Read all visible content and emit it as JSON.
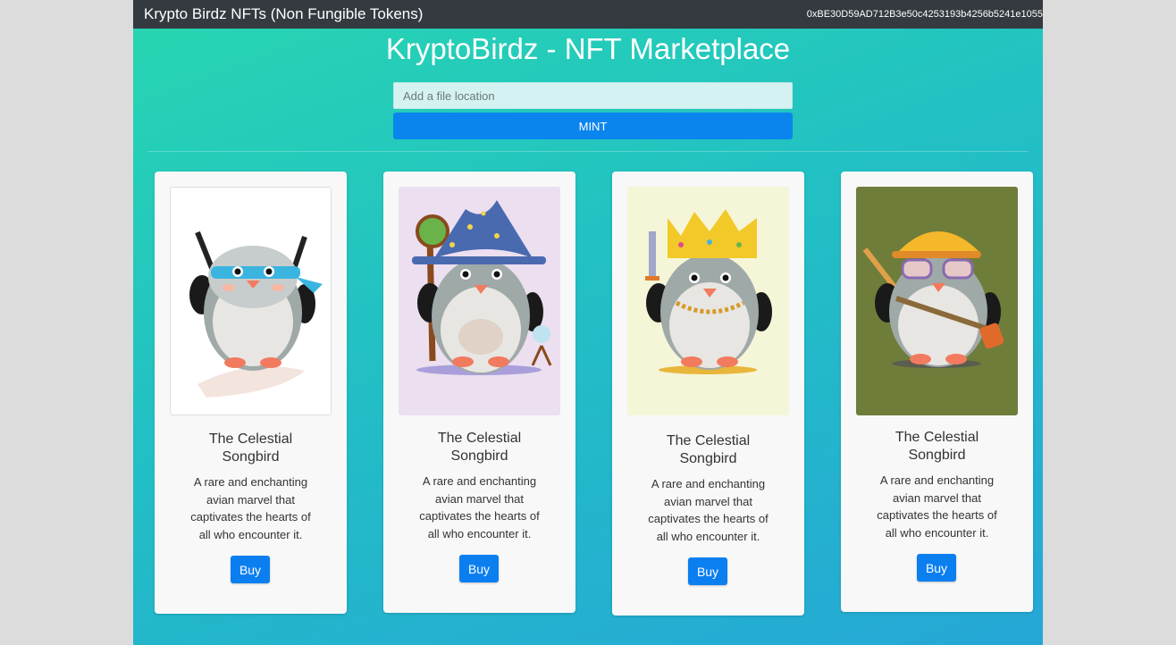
{
  "navbar": {
    "brand": "Krypto Birdz NFTs (Non Fungible Tokens)",
    "account": "0xBE30D59AD712B3e50c4253193b4256b5241e1055"
  },
  "header": {
    "title": "KryptoBirdz - NFT Marketplace"
  },
  "mint_form": {
    "placeholder": "Add a file location",
    "value": "",
    "button_label": "MINT"
  },
  "cards": [
    {
      "image": "ninja-penguin-illustration",
      "title_line1": "The Celestial",
      "title_line2": "Songbird",
      "desc": [
        "A rare and enchanting",
        "avian marvel that",
        "captivates the hearts of",
        "all who encounter it."
      ],
      "buy_label": "Buy",
      "image_bg": "#ffffff"
    },
    {
      "image": "wizard-penguin-illustration",
      "title_line1": "The Celestial",
      "title_line2": "Songbird",
      "desc": [
        "A rare and enchanting",
        "avian marvel that",
        "captivates the hearts of",
        "all who encounter it."
      ],
      "buy_label": "Buy",
      "image_bg": "#ecdff0"
    },
    {
      "image": "king-penguin-illustration",
      "title_line1": "The Celestial",
      "title_line2": "Songbird",
      "desc": [
        "A rare and enchanting",
        "avian marvel that",
        "captivates the hearts of",
        "all who encounter it."
      ],
      "buy_label": "Buy",
      "image_bg": "#f5f5d8"
    },
    {
      "image": "builder-penguin-illustration",
      "title_line1": "The Celestial",
      "title_line2": "Songbird",
      "desc": [
        "A rare and enchanting",
        "avian marvel that",
        "captivates the hearts of",
        "all who encounter it."
      ],
      "buy_label": "Buy",
      "image_bg": "#6f7d3a"
    }
  ],
  "colors": {
    "navbar": "#343a40",
    "mint_button": "#0b85ee",
    "buy_button": "#0b7ff0",
    "gradient_start": "#27d6b0",
    "gradient_end": "#25a7d6"
  }
}
